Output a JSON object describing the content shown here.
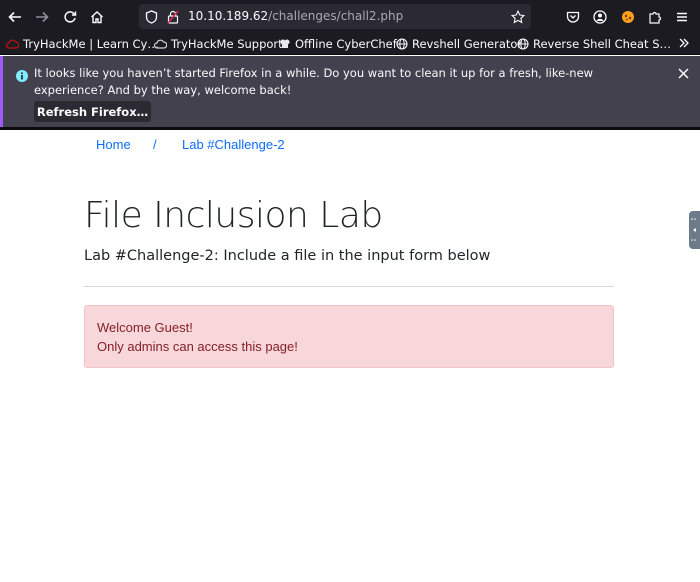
{
  "browser": {
    "url_host": "10.10.189.62",
    "url_path": "/challenges/chall2.php",
    "icons": [
      "back-icon",
      "forward-icon",
      "reload-icon",
      "home-icon",
      "shield-icon",
      "lock-icon",
      "star-icon",
      "pocket-icon",
      "account-icon",
      "extension-icon",
      "extensions-puzzle-icon",
      "menu-icon"
    ]
  },
  "bookmarks": [
    {
      "label": "TryHackMe | Learn Cy…",
      "icon": "tryhackme-icon"
    },
    {
      "label": "TryHackMe Support",
      "icon": "support-icon"
    },
    {
      "label": "Offline CyberChef",
      "icon": "chef-icon"
    },
    {
      "label": "Revshell Generator",
      "icon": "globe-icon"
    },
    {
      "label": "Reverse Shell Cheat S…",
      "icon": "globe-icon"
    }
  ],
  "notification": {
    "message": "It looks like you haven’t started Firefox in a while. Do you want to clean it up for a fresh, like-new experience? And by the way, welcome back!",
    "button_label": "Refresh Firefox…"
  },
  "breadcrumb": {
    "home": "Home",
    "separator": "/",
    "current": "Lab #Challenge-2"
  },
  "page": {
    "title": "File Inclusion Lab",
    "subtitle": "Lab #Challenge-2: Include a file in the input form below"
  },
  "alert": {
    "line1": "Welcome Guest!",
    "line2": "Only admins can access this page!"
  },
  "colors": {
    "chrome_bg": "#1c1b22",
    "link": "#0d6efd",
    "alert_bg": "#f8d7da",
    "alert_text": "#842029"
  }
}
